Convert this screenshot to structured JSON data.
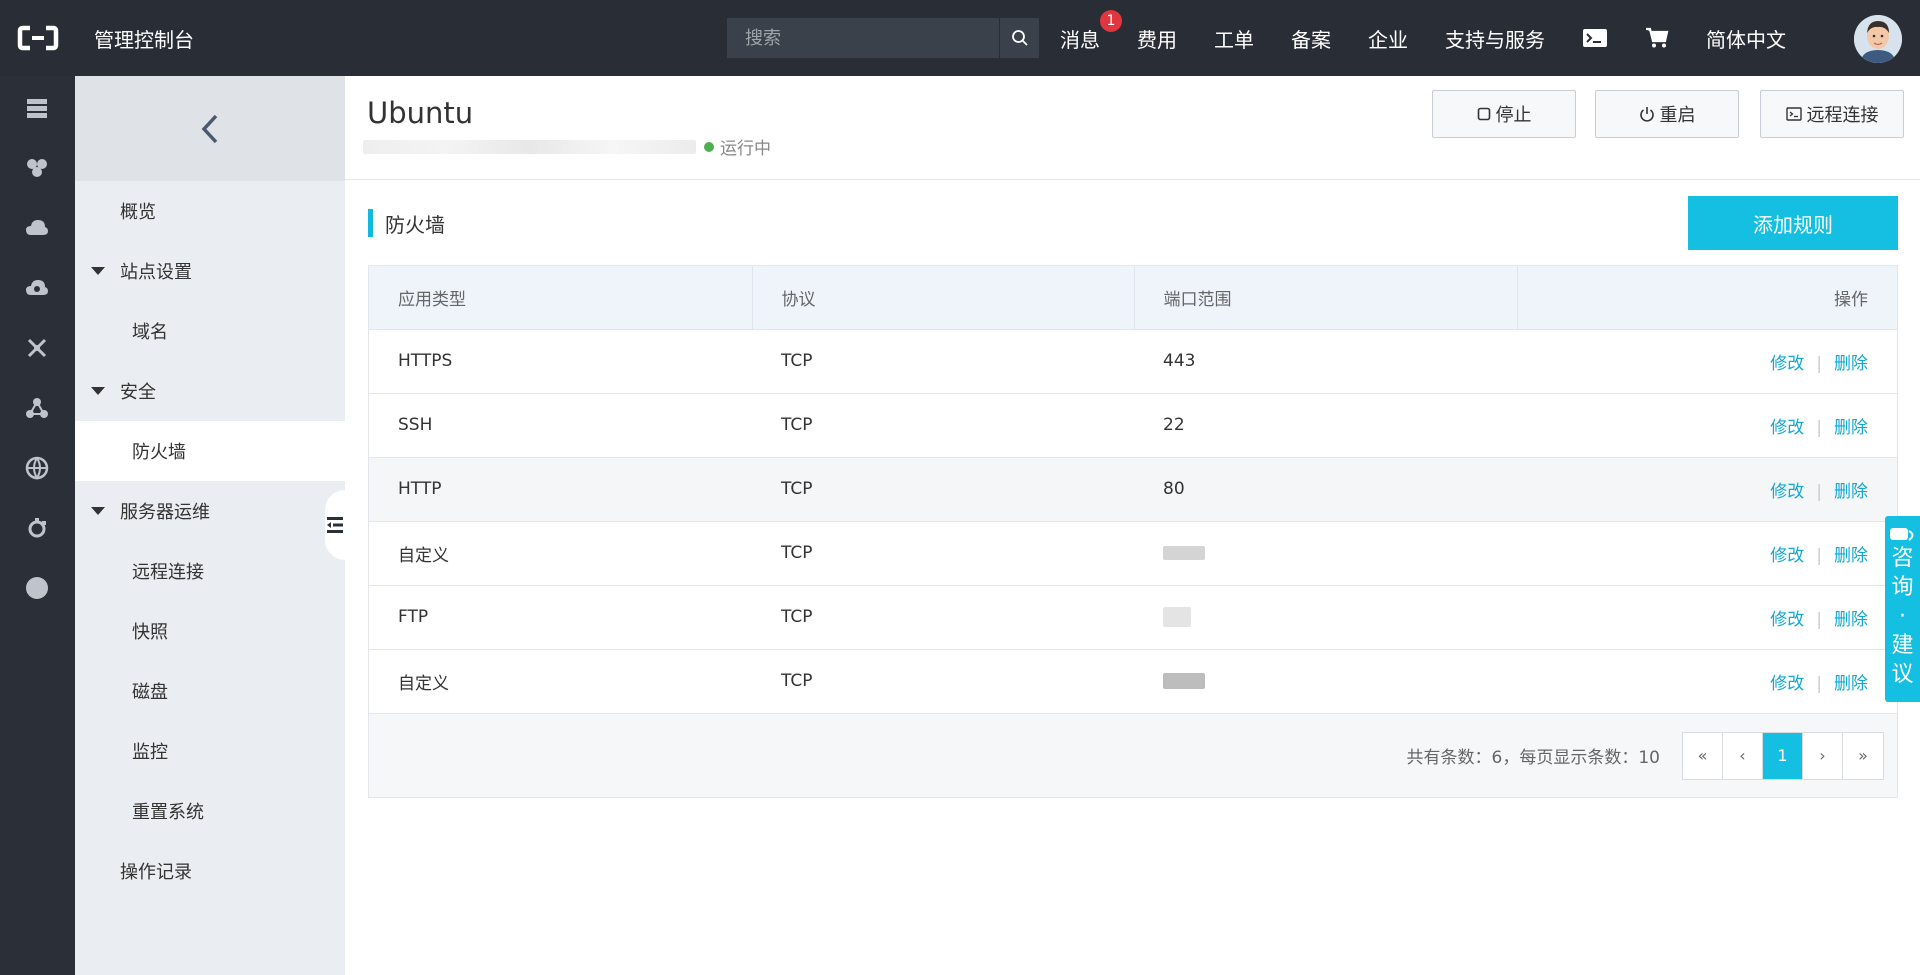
{
  "topbar": {
    "title": "管理控制台",
    "search_placeholder": "搜索",
    "nav": [
      {
        "label": "消息",
        "badge": "1"
      },
      {
        "label": "费用"
      },
      {
        "label": "工单"
      },
      {
        "label": "备案"
      },
      {
        "label": "企业"
      },
      {
        "label": "支持与服务"
      }
    ],
    "language": "简体中文"
  },
  "sidebar": {
    "items": [
      {
        "label": "概览"
      },
      {
        "label": "站点设置"
      },
      {
        "label": "域名"
      },
      {
        "label": "安全"
      },
      {
        "label": "防火墙"
      },
      {
        "label": "服务器运维"
      },
      {
        "label": "远程连接"
      },
      {
        "label": "快照"
      },
      {
        "label": "磁盘"
      },
      {
        "label": "监控"
      },
      {
        "label": "重置系统"
      },
      {
        "label": "操作记录"
      }
    ]
  },
  "instance": {
    "name": "Ubuntu",
    "status": "运行中",
    "status_color": "#4cb050",
    "buttons": {
      "stop": "停止",
      "restart": "重启",
      "remote": "远程连接"
    }
  },
  "firewall": {
    "title": "防火墙",
    "add_button": "添加规则",
    "columns": [
      "应用类型",
      "协议",
      "端口范围",
      "操作"
    ],
    "rows": [
      {
        "app": "HTTPS",
        "protocol": "TCP",
        "port": "443"
      },
      {
        "app": "SSH",
        "protocol": "TCP",
        "port": "22"
      },
      {
        "app": "HTTP",
        "protocol": "TCP",
        "port": "80"
      },
      {
        "app": "自定义",
        "protocol": "TCP",
        "port": ""
      },
      {
        "app": "FTP",
        "protocol": "TCP",
        "port": ""
      },
      {
        "app": "自定义",
        "protocol": "TCP",
        "port": ""
      }
    ],
    "actions": {
      "edit": "修改",
      "delete": "删除",
      "separator": "|"
    },
    "footer_info": "共有条数：6，每页显示条数：10",
    "pager": {
      "first": "«",
      "prev": "‹",
      "current": "1",
      "next": "›",
      "last": "»"
    }
  },
  "consult": {
    "chars": [
      "咨",
      "询",
      "·",
      "建",
      "议"
    ]
  },
  "colors": {
    "accent": "#14bfe2",
    "topbar": "#292e36",
    "link": "#10a8d4"
  }
}
